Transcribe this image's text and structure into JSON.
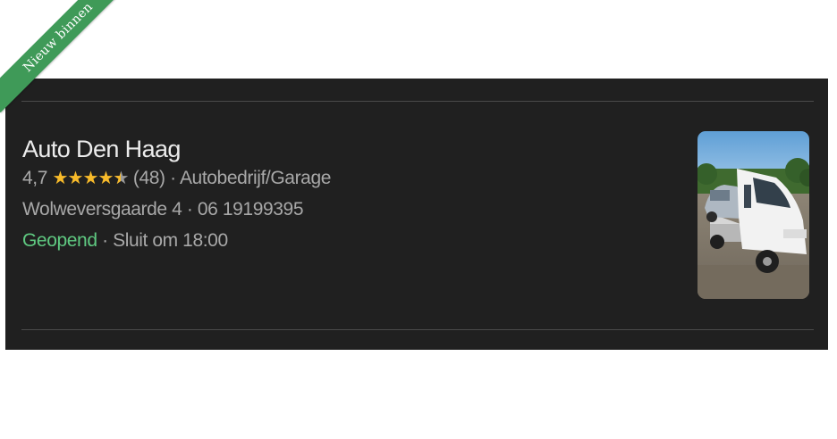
{
  "ribbon": {
    "label": "Nieuw binnen",
    "color": "#3f9a58"
  },
  "listing": {
    "name": "Auto Den Haag",
    "rating": "4,7",
    "stars_value": 4.7,
    "stars_max": 5,
    "review_count": "(48)",
    "separator": "·",
    "category": "Autobedrijf/Garage",
    "address": "Wolweversgaarde 4",
    "phone": "06 19199395",
    "status": "Geopend",
    "status_color": "#5fc981",
    "closing": "Sluit om 18:00",
    "thumbnail_icon": "tow-truck-photo"
  },
  "colors": {
    "card_background": "#202020",
    "star_color": "#f7ba2a"
  }
}
